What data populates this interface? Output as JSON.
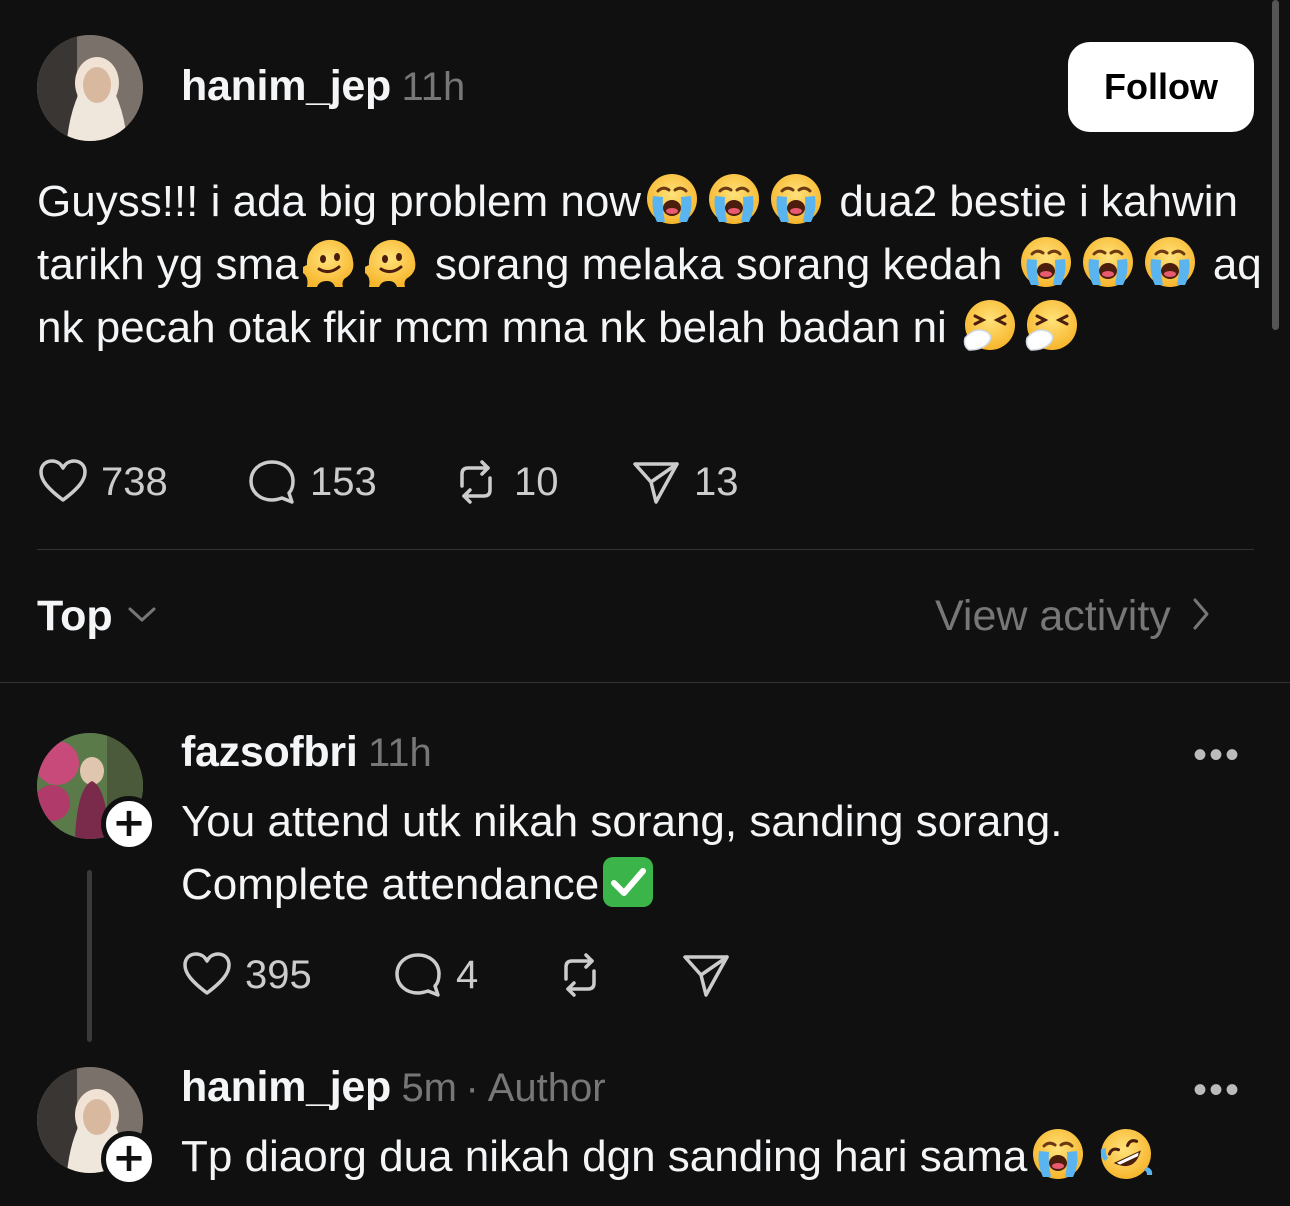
{
  "post": {
    "username": "hanim_jep",
    "time": "11h",
    "follow_label": "Follow",
    "text_segments": [
      "Guyss!!! i ada big problem now",
      "dua2 bestie i kahwin tarikh yg sma",
      "sorang melaka sorang kedah",
      "aq nk pecah otak fkir mcm mna nk belah badan ni"
    ],
    "emoji": {
      "crying": "loudly-crying-face-emoji",
      "melting": "melting-face-emoji",
      "sneezing": "sneezing-face-emoji"
    },
    "likes": "738",
    "comments": "153",
    "reposts": "10",
    "shares": "13"
  },
  "sort": {
    "label": "Top",
    "view_activity": "View activity"
  },
  "replies": [
    {
      "username": "fazsofbri",
      "time": "11h",
      "text_line1": "You attend utk nikah sorang, sanding sorang.",
      "text_line2": "Complete attendance",
      "emoji": "check-mark-button-emoji",
      "likes": "395",
      "comments": "4",
      "more": "•••"
    },
    {
      "username": "hanim_jep",
      "time": "5m",
      "author_tag": "· Author",
      "text": "Tp diaorg dua nikah dgn sanding hari sama",
      "emoji": [
        "loudly-crying-face-emoji",
        "rolling-on-the-floor-laughing-emoji"
      ],
      "more": "•••"
    }
  ],
  "colors": {
    "background": "#101010",
    "text": "#f3f5f7",
    "muted": "#777777",
    "follow_bg": "#ffffff"
  }
}
